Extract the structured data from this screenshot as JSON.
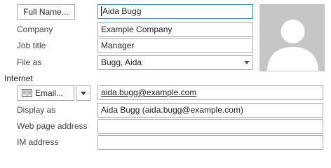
{
  "contact": {
    "full_name_button": "Full Name...",
    "full_name_value": "Aida Bugg",
    "company_label": "Company",
    "company_value": "Example Company",
    "job_title_label": "Job title",
    "job_title_value": "Manager",
    "file_as_label": "File as",
    "file_as_value": "Bugg, Aida"
  },
  "internet": {
    "section_label": "Internet",
    "email_button": "Email...",
    "email_value": "aida.bugg@example.com",
    "display_as_label": "Display as",
    "display_as_value": "Aida Bugg (aida.bugg@example.com)",
    "web_page_label": "Web page address",
    "web_page_value": "",
    "im_label": "IM address",
    "im_value": ""
  },
  "icons": {
    "email_icon": "address-card-icon",
    "dropdown_icon": "chevron-down-icon",
    "photo": "person-silhouette-icon"
  },
  "colors": {
    "focus_border": "#3b8ec4",
    "field_border": "#ababab",
    "photo_bg": "#c6c6c6"
  }
}
